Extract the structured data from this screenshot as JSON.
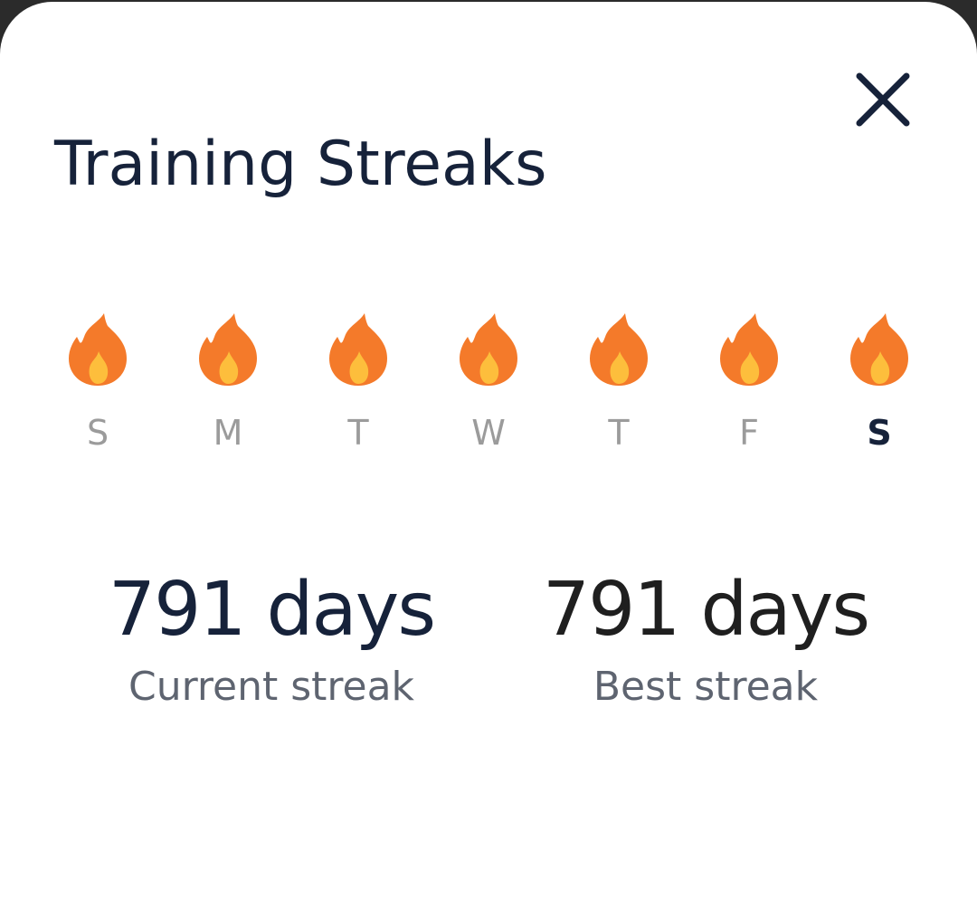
{
  "modal": {
    "title": "Training Streaks",
    "close_icon": "close-icon"
  },
  "colors": {
    "title": "#16223a",
    "day_inactive": "#9b9b9b",
    "day_today": "#16223a",
    "flame_outer": "#f47a2a",
    "flame_inner": "#fdbe3c",
    "stat_label": "#5e6470"
  },
  "week": {
    "days": [
      {
        "label": "S",
        "icon": "flame-icon",
        "today": false
      },
      {
        "label": "M",
        "icon": "flame-icon",
        "today": false
      },
      {
        "label": "T",
        "icon": "flame-icon",
        "today": false
      },
      {
        "label": "W",
        "icon": "flame-icon",
        "today": false
      },
      {
        "label": "T",
        "icon": "flame-icon",
        "today": false
      },
      {
        "label": "F",
        "icon": "flame-icon",
        "today": false
      },
      {
        "label": "S",
        "icon": "flame-icon",
        "today": true
      }
    ]
  },
  "stats": {
    "current": {
      "value": "791 days",
      "label": "Current streak",
      "color": "#16223a"
    },
    "best": {
      "value": "791 days",
      "label": "Best streak",
      "color": "#1f1f1f"
    }
  }
}
